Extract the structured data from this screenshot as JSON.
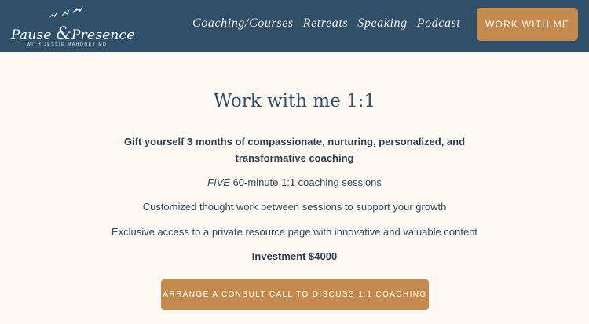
{
  "header": {
    "logo": {
      "name_part1": "Pause ",
      "ampersand": "&",
      "name_part2": "Presence",
      "subtitle": "WITH JESSIE MAHONEY MD"
    },
    "nav": [
      "Coaching/Courses",
      "Retreats",
      "Speaking",
      "Podcast"
    ],
    "cta_label": "WORK WITH ME"
  },
  "main": {
    "title": "Work with me 1:1",
    "gift": "Gift yourself 3 months of compassionate, nurturing, personalized, and transformative coaching",
    "sessions_emph": "FIVE",
    "sessions_rest": " 60-minute 1:1 coaching sessions",
    "thought_work": "Customized thought work between sessions to support your growth",
    "resource_access": "Exclusive access to a private resource page with innovative and valuable content",
    "investment": "Investment $4000",
    "cta_label": "ARRANGE A CONSULT CALL TO DISCUSS 1:1 COACHING"
  },
  "colors": {
    "header_bg": "#2f5068",
    "accent": "#c4894c",
    "page_bg": "#fdf9f2"
  },
  "icons": {
    "logo_birds": "birds-icon"
  }
}
